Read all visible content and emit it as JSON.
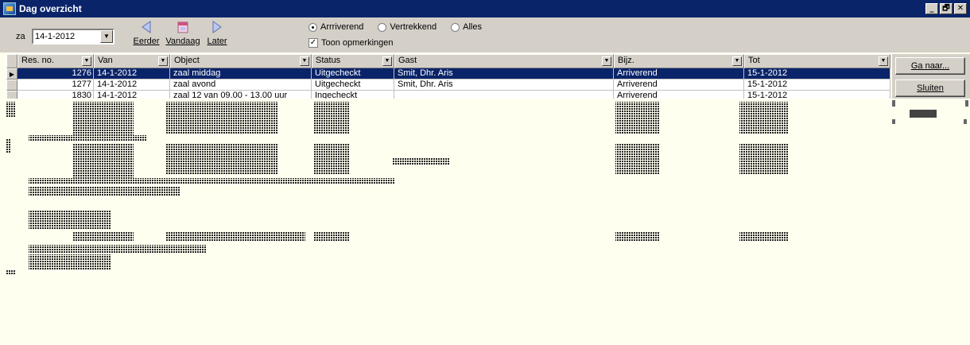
{
  "window": {
    "title": "Dag overzicht",
    "controls": [
      "_",
      "🗗",
      "✕"
    ]
  },
  "toolbar": {
    "day_prefix": "za",
    "date_value": "14-1-2012",
    "prev_label": "Eerder",
    "today_label": "Vandaag",
    "next_label": "Later",
    "radio_options": [
      "Arrriverend",
      "Vertrekkend",
      "Alles"
    ],
    "selected_radio": "Arrriverend",
    "show_notes_label": "Toon opmerkingen",
    "show_notes_checked": true
  },
  "grid": {
    "columns": [
      "Res. no.",
      "Van",
      "Object",
      "Status",
      "Gast",
      "Bijz.",
      "Tot"
    ],
    "rows": [
      {
        "res_no": "1276",
        "van": "14-1-2012",
        "object": "zaal middag",
        "status": "Uitgecheckt",
        "gast": "Smit, Dhr. Aris",
        "bijz": "Arriverend",
        "tot": "15-1-2012",
        "selected": true
      },
      {
        "res_no": "1277",
        "van": "14-1-2012",
        "object": "zaal avond",
        "status": "Uitgecheckt",
        "gast": "Smit, Dhr. Aris",
        "bijz": "Arriverend",
        "tot": "15-1-2012",
        "selected": false
      },
      {
        "res_no": "1830",
        "van": "14-1-2012",
        "object": "zaal 12 van 09.00 - 13.00 uur",
        "status": "Ingecheckt",
        "gast": "",
        "bijz": "Arriverend",
        "tot": "15-1-2012",
        "selected": false
      }
    ]
  },
  "side": {
    "goto_label": "Ga naar...",
    "close_label": "Sluiten"
  },
  "colors": {
    "titlebar": "#0a246a",
    "selection": "#0a246a",
    "face": "#d4d0c8",
    "canvas": "#fffff0"
  }
}
